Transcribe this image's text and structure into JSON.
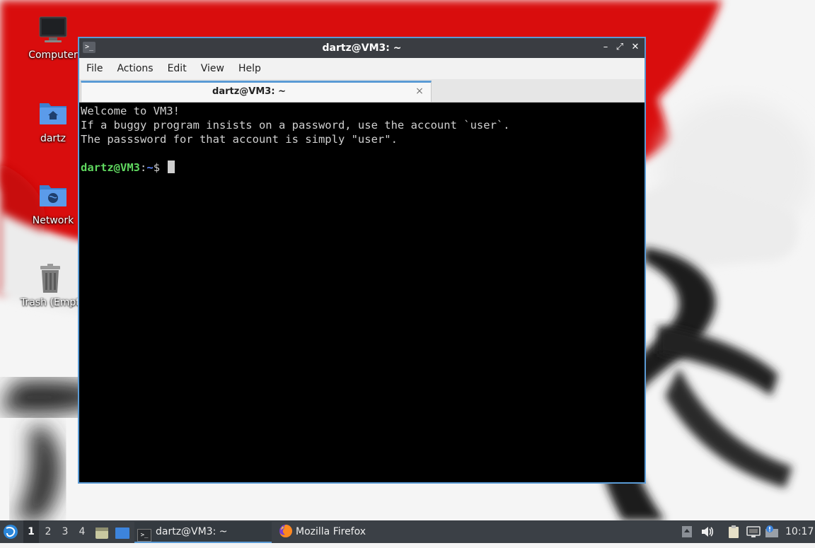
{
  "desktop": {
    "icons": [
      {
        "label": "Computer",
        "icon": "computer-icon"
      },
      {
        "label": "dartz",
        "icon": "home-folder-icon"
      },
      {
        "label": "Network",
        "icon": "network-folder-icon"
      },
      {
        "label": "Trash (Empty)",
        "icon": "trash-icon"
      }
    ]
  },
  "window": {
    "title": "dartz@VM3: ~",
    "menu": [
      "File",
      "Actions",
      "Edit",
      "View",
      "Help"
    ],
    "tab_label": "dartz@VM3: ~",
    "tab_close": "×",
    "controls": {
      "minimize": "–",
      "maximize": "⤢",
      "close": "✕"
    }
  },
  "terminal": {
    "lines": [
      "Welcome to VM3!",
      "If a buggy program insists on a password, use the account `user`.",
      "The passsword for that account is simply \"user\"."
    ],
    "prompt_user": "dartz@VM3",
    "prompt_sep": ":",
    "prompt_path": "~",
    "prompt_end": "$ "
  },
  "taskbar": {
    "workspaces": [
      "1",
      "2",
      "3",
      "4"
    ],
    "active_workspace": "1",
    "tasks": [
      {
        "label": "dartz@VM3: ~",
        "icon": "terminal-icon",
        "active": true
      },
      {
        "label": "Mozilla Firefox",
        "icon": "firefox-icon",
        "active": false
      }
    ],
    "clock": "10:17"
  },
  "colors": {
    "accent": "#5b9bd5",
    "titlebar": "#3a3d42",
    "taskbar": "#3b4046",
    "prompt_user": "#5fd75f",
    "prompt_path": "#5f87ff",
    "wallpaper_red": "#d90f0f"
  }
}
